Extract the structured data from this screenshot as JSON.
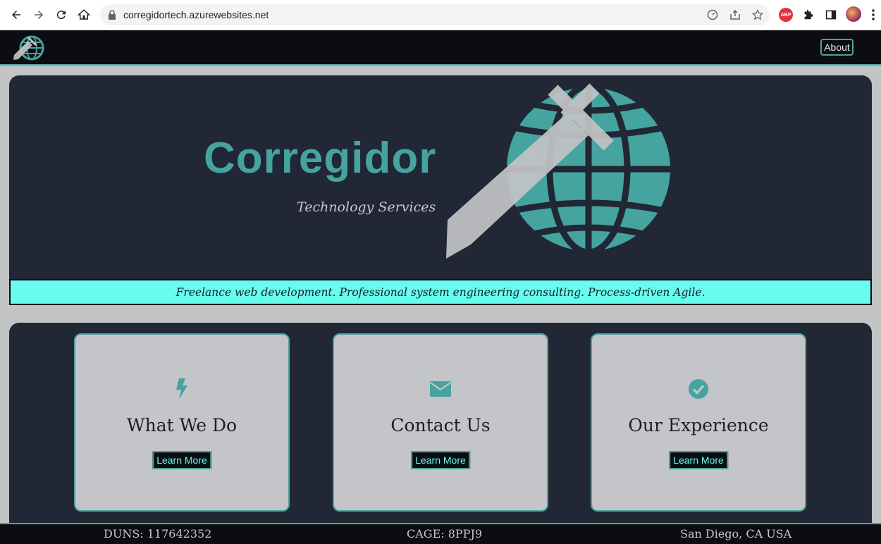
{
  "browser": {
    "url": "corregidortech.azurewebsites.net",
    "extension_abp": "ABP"
  },
  "nav": {
    "about_label": "About"
  },
  "hero": {
    "title": "Corregidor",
    "subtitle": "Technology Services",
    "tagline": "Freelance web development. Professional system engineering consulting. Process-driven Agile."
  },
  "cards": [
    {
      "icon": "lightning-bolt-icon",
      "title": "What We Do",
      "button": "Learn More"
    },
    {
      "icon": "envelope-icon",
      "title": "Contact Us",
      "button": "Learn More"
    },
    {
      "icon": "check-circle-icon",
      "title": "Our Experience",
      "button": "Learn More"
    }
  ],
  "footer": {
    "duns": "DUNS: 117642352",
    "cage": "CAGE: 8PPJ9",
    "location": "San Diego, CA USA"
  },
  "colors": {
    "accent_teal": "#4aa3a0",
    "highlight_cyan": "#66fcee",
    "panel_dark": "#212734",
    "nav_black": "#0b0d11",
    "page_gray": "#c2c3c5"
  }
}
